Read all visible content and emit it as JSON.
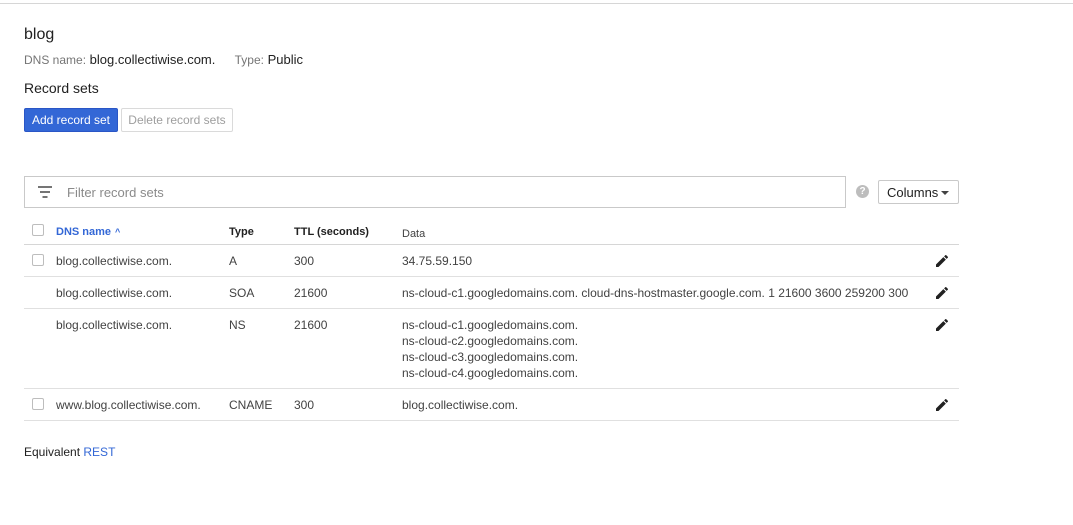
{
  "zone": {
    "name": "blog",
    "dns_name_label": "DNS name:",
    "dns_name": "blog.collectiwise.com.",
    "type_label": "Type:",
    "type": "Public"
  },
  "record_sets": {
    "title": "Record sets",
    "add_button": "Add record set",
    "delete_button": "Delete record sets"
  },
  "filter": {
    "placeholder": "Filter record sets",
    "help_glyph": "?",
    "columns_label": "Columns"
  },
  "table": {
    "headers": {
      "dns_name": "DNS name",
      "sort_indicator": "^",
      "type": "Type",
      "ttl": "TTL (seconds)",
      "data": "Data"
    },
    "rows": [
      {
        "dns_name": "blog.collectiwise.com.",
        "type": "A",
        "ttl": "300",
        "data": [
          "34.75.59.150"
        ],
        "has_checkbox": true
      },
      {
        "dns_name": "blog.collectiwise.com.",
        "type": "SOA",
        "ttl": "21600",
        "data": [
          "ns-cloud-c1.googledomains.com. cloud-dns-hostmaster.google.com. 1 21600 3600 259200 300"
        ],
        "has_checkbox": false
      },
      {
        "dns_name": "blog.collectiwise.com.",
        "type": "NS",
        "ttl": "21600",
        "data": [
          "ns-cloud-c1.googledomains.com.",
          "ns-cloud-c2.googledomains.com.",
          "ns-cloud-c3.googledomains.com.",
          "ns-cloud-c4.googledomains.com."
        ],
        "has_checkbox": false
      },
      {
        "dns_name": "www.blog.collectiwise.com.",
        "type": "CNAME",
        "ttl": "300",
        "data": [
          "blog.collectiwise.com."
        ],
        "has_checkbox": true
      }
    ]
  },
  "footer": {
    "equivalent_label": "Equivalent",
    "rest_link": "REST"
  },
  "colors": {
    "primary": "#3367d6",
    "divider": "#e0e0e0",
    "text": "#212121"
  },
  "icons": {
    "filter": "filter-list-icon",
    "help": "help-icon",
    "dropdown": "caret-down-icon",
    "edit": "pencil-edit-icon",
    "sort": "sort-ascending-icon"
  }
}
